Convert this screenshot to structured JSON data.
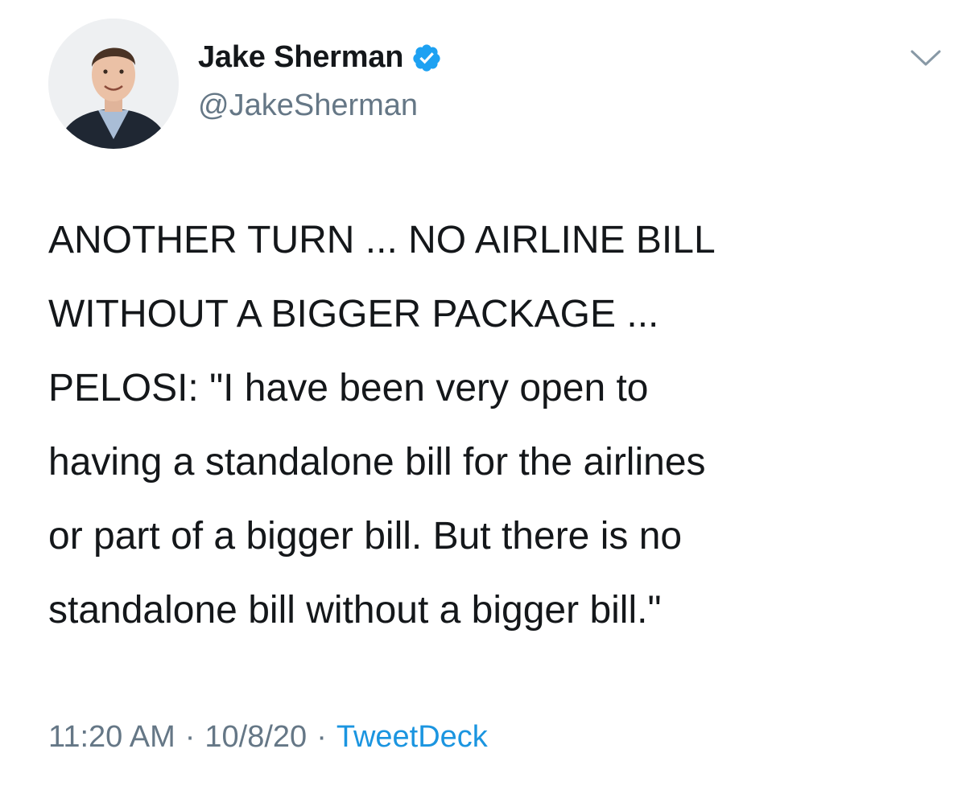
{
  "author": {
    "display_name": "Jake Sherman",
    "handle": "@JakeSherman",
    "verified": true,
    "verified_color": "#1da1f2"
  },
  "tweet": {
    "text": "ANOTHER TURN ... NO AIRLINE BILL\nWITHOUT A BIGGER PACKAGE ...\nPELOSI: \"I have been very open to\nhaving a standalone bill for the airlines\nor part of a bigger bill. But there is no\nstandalone bill without a bigger bill.\""
  },
  "meta": {
    "time": "11:20 AM",
    "separator": "·",
    "date": "10/8/20",
    "source": "TweetDeck",
    "source_color": "#1b95e0"
  },
  "icons": {
    "menu": "chevron-down-icon",
    "verified": "verified-badge-icon"
  }
}
